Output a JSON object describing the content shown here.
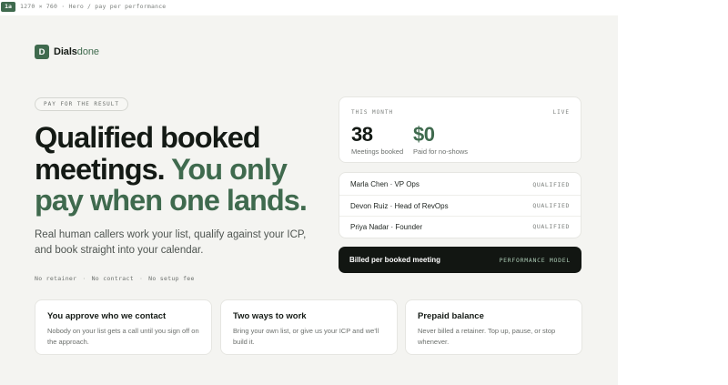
{
  "topbar": {
    "badge": "1a",
    "crumb": "1270 × 760 · Hero / pay per performance"
  },
  "logo": {
    "mark": "D",
    "name_part1": "Dials",
    "name_part2": "done"
  },
  "hero": {
    "pill": "PAY FOR THE RESULT",
    "headline_line1": "Qualified booked",
    "headline_line2_dark": "meetings. ",
    "headline_line2_green": "You only",
    "headline_line3": "pay when one lands.",
    "subtext": "Real human callers work your list, qualify against your ICP, and book straight into your calendar.",
    "meta": [
      "No retainer",
      "No contract",
      "No setup fee"
    ],
    "meta_separator": "·"
  },
  "stats": {
    "label": "THIS MONTH",
    "status": "LIVE",
    "meetings_value": "38",
    "meetings_caption": "Meetings booked",
    "paid_value": "$0",
    "paid_caption": "Paid for no-shows"
  },
  "meetings": [
    {
      "name": "Marla Chen · VP Ops",
      "status": "QUALIFIED"
    },
    {
      "name": "Devon Ruiz · Head of RevOps",
      "status": "QUALIFIED"
    },
    {
      "name": "Priya Nadar · Founder",
      "status": "QUALIFIED"
    }
  ],
  "billing": {
    "title": "Billed per booked meeting",
    "model": "PERFORMANCE MODEL"
  },
  "features": [
    {
      "title": "You approve who we contact",
      "desc": "Nobody on your list gets a call until you sign off on the approach."
    },
    {
      "title": "Two ways to work",
      "desc": "Bring your own list, or give us your ICP and we'll build it."
    },
    {
      "title": "Prepaid balance",
      "desc": "Never billed a retainer. Top up, pause, or stop whenever."
    }
  ],
  "colors": {
    "accent": "#3f6a4e",
    "dark": "#121612",
    "background": "#f4f4f1"
  }
}
